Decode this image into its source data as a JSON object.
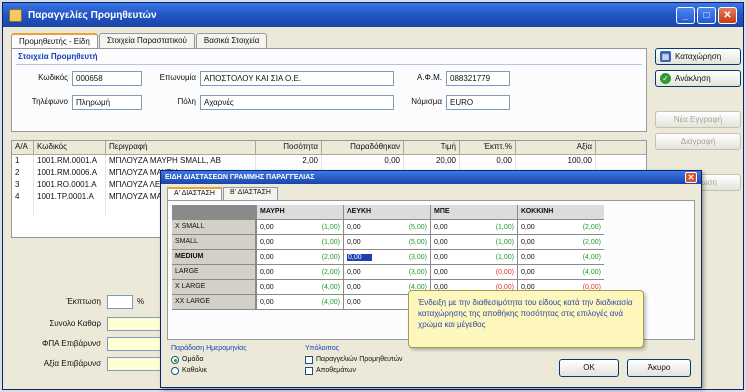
{
  "window": {
    "title": "Παραγγελίες Προμηθευτών",
    "minimize": "_",
    "maximize": "□",
    "close": "✕"
  },
  "tabs": [
    "Προμηθευτής - Είδη",
    "Στοιχεία Παραστατικού",
    "Βασικά Στοιχεία"
  ],
  "header": {
    "group_title": "Στοιχεία Προμηθευτή",
    "code_label": "Κωδικός",
    "code_value": "000658",
    "name_label": "Επωνυμία",
    "name_value": "ΑΠΟΣΤΟΛΟΥ ΚΑΙ ΣΙΑ Ο.Ε.",
    "afm_label": "Α.Φ.Μ.",
    "afm_value": "088321779",
    "phone_label": "Τηλέφωνο",
    "phone_value": "Πληρωμή",
    "city_label": "Πόλη",
    "city_value": "Αχαρνές",
    "currency_label": "Νόμισμα",
    "currency_value": "EURO"
  },
  "items": {
    "columns": [
      "Α/Α",
      "Κωδικός",
      "Περιγραφή",
      "Ποσότητα",
      "Παραδόθηκαν",
      "Τιμή",
      "Έκπτ.%",
      "Αξία"
    ],
    "rows": [
      [
        "1",
        "1001.RM.0001.A",
        "ΜΠΛΟΥΖΑ ΜΑΥΡΗ SMALL, AB",
        "2,00",
        "0,00",
        "20,00",
        "0,00",
        "100,00"
      ],
      [
        "2",
        "1001.RM.0006.A",
        "ΜΠΛΟΥΖΑ ΜΑΥΡΗ",
        "",
        "",
        "",
        "",
        ""
      ],
      [
        "3",
        "1001.RO.0001.A",
        "ΜΠΛΟΥΖΑ ΛΕΥΚΗ",
        "",
        "",
        "",
        "",
        ""
      ],
      [
        "4",
        "1001.TP.0001.A",
        "ΜΠΛΟΥΖΑ ΜΑΥΡΗ",
        "",
        "",
        "",
        "",
        ""
      ],
      [
        "",
        "",
        "",
        "",
        "",
        "",
        "",
        ""
      ]
    ]
  },
  "totals": {
    "discount_label": "Έκπτωση",
    "discount_unit": "%",
    "net_label": "Συνολο Καθαρ",
    "vat_label": "ΦΠΑ Επιβάρυνσ",
    "total_label": "Αξία Επιβάρυνσ"
  },
  "side_buttons": {
    "calendar": "Καταχώρηση",
    "save": "Ανάκληση",
    "disabled": [
      "Νέα Εγγραφή",
      "Διαγραφή",
      "Εκτύπωση"
    ]
  },
  "dialog": {
    "title": "ΕΙΔΗ ΔΙΑΣΤΑΣΕΩΝ ΓΡΑΜΜΗΣ ΠΑΡΑΓΓΕΛΙΑΣ",
    "close": "✕",
    "tabs": [
      "Α' ΔΙΑΣΤΑΣΗ",
      "Β' ΔΙΑΣΤΑΣΗ"
    ],
    "colors": [
      "ΜΑΥΡΗ",
      "ΛΕΥΚΗ",
      "ΜΠΕ",
      "ΚΟΚΚΙΝΗ"
    ],
    "sizes": [
      {
        "label": "X SMALL",
        "bold": false,
        "cells": [
          [
            "0,00",
            "(1,00)"
          ],
          [
            "0,00",
            "(5,00)"
          ],
          [
            "0,00",
            "(1,00)"
          ],
          [
            "0,00",
            "(2,00)"
          ]
        ]
      },
      {
        "label": "SMALL",
        "bold": false,
        "cells": [
          [
            "0,00",
            "(1,00)"
          ],
          [
            "0,00",
            "(5,00)"
          ],
          [
            "0,00",
            "(1,00)"
          ],
          [
            "0,00",
            "(2,00)"
          ]
        ]
      },
      {
        "label": "MEDIUM",
        "bold": true,
        "cells": [
          [
            "0,00",
            "(2,00)"
          ],
          [
            "0,00",
            "(3,00)"
          ],
          [
            "0,00",
            "(1,00)"
          ],
          [
            "0,00",
            "(4,00)"
          ]
        ]
      },
      {
        "label": "LARGE",
        "bold": false,
        "cells": [
          [
            "0,00",
            "(2,00)"
          ],
          [
            "0,00",
            "(3,00)"
          ],
          [
            "0,00",
            "(0,00)"
          ],
          [
            "0,00",
            "(4,00)"
          ]
        ]
      },
      {
        "label": "X LARGE",
        "bold": false,
        "cells": [
          [
            "0,00",
            "(4,00)"
          ],
          [
            "0,00",
            "(4,00)"
          ],
          [
            "0,00",
            "(0,00)"
          ],
          [
            "0,00",
            "(0,00)"
          ]
        ]
      },
      {
        "label": "XX LARGE",
        "bold": false,
        "cells": [
          [
            "0,00",
            "(4,00)"
          ],
          [
            "0,00",
            "(4,00)"
          ],
          [
            "0,00",
            "(0,00)"
          ],
          [
            "0,00",
            "(0,00)"
          ]
        ]
      }
    ],
    "tooltip": "Ένδειξη με την διαθεσιμότητα του είδους κατά την διαδικασία καταχώρησης της αποθήκης ποσότητας στις επιλογές ανά χρώμα και μέγεθος",
    "footer": {
      "group1_title": "Παράδοση Ημερομηνίας",
      "option1": "Ομάδα",
      "option2": "Καθολικ",
      "group2_title": "Υπόλοιπος",
      "check1": "Παραγγελιών Προμηθευτών",
      "check2": "Αποθεμάτων",
      "ok": "ΟΚ",
      "cancel": "Άκυρο"
    }
  }
}
